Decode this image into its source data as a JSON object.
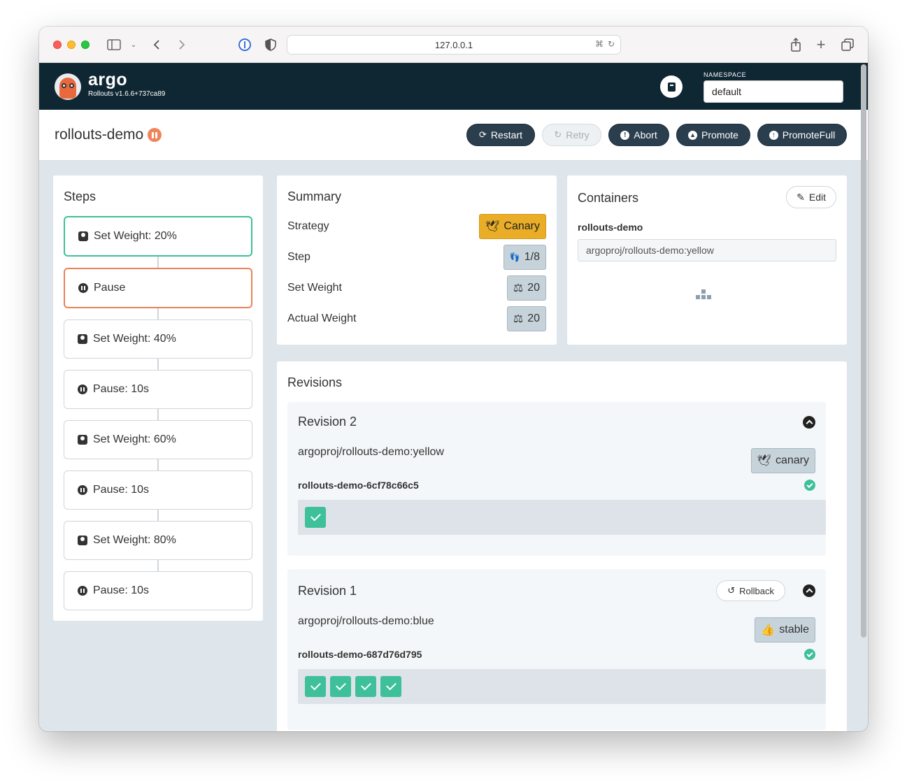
{
  "browser": {
    "url": "127.0.0.1"
  },
  "app": {
    "brand": "argo",
    "version": "Rollouts v1.6.6+737ca89",
    "namespace_label": "NAMESPACE",
    "namespace_value": "default"
  },
  "rollout": {
    "name": "rollouts-demo",
    "status": "paused",
    "actions": {
      "restart": "Restart",
      "retry": "Retry",
      "abort": "Abort",
      "promote": "Promote",
      "promote_full": "PromoteFull"
    }
  },
  "steps": {
    "title": "Steps",
    "items": [
      {
        "label": "Set Weight: 20%",
        "type": "weight",
        "state": "done"
      },
      {
        "label": "Pause",
        "type": "pause",
        "state": "current"
      },
      {
        "label": "Set Weight: 40%",
        "type": "weight",
        "state": "pending"
      },
      {
        "label": "Pause: 10s",
        "type": "pause",
        "state": "pending"
      },
      {
        "label": "Set Weight: 60%",
        "type": "weight",
        "state": "pending"
      },
      {
        "label": "Pause: 10s",
        "type": "pause",
        "state": "pending"
      },
      {
        "label": "Set Weight: 80%",
        "type": "weight",
        "state": "pending"
      },
      {
        "label": "Pause: 10s",
        "type": "pause",
        "state": "pending"
      }
    ]
  },
  "summary": {
    "title": "Summary",
    "rows": [
      {
        "label": "Strategy",
        "value": "Canary",
        "icon": "dove-icon"
      },
      {
        "label": "Step",
        "value": "1/8",
        "icon": "shoe-prints-icon"
      },
      {
        "label": "Set Weight",
        "value": "20",
        "icon": "balance-scale-icon"
      },
      {
        "label": "Actual Weight",
        "value": "20",
        "icon": "balance-scale-icon"
      }
    ]
  },
  "containers": {
    "title": "Containers",
    "edit_label": "Edit",
    "name": "rollouts-demo",
    "image": "argoproj/rollouts-demo:yellow"
  },
  "revisions": {
    "title": "Revisions",
    "items": [
      {
        "title": "Revision 2",
        "image": "argoproj/rollouts-demo:yellow",
        "badge": "canary",
        "replicaset": "rollouts-demo-6cf78c66c5",
        "pods": 1
      },
      {
        "title": "Revision 1",
        "rollback_label": "Rollback",
        "image": "argoproj/rollouts-demo:blue",
        "badge": "stable",
        "replicaset": "rollouts-demo-687d76d795",
        "pods": 4
      }
    ]
  },
  "colors": {
    "header_bg": "#0f2733",
    "button_dark": "#2b3e4e",
    "success": "#3ec09a",
    "paused": "#f0855c",
    "canary": "#e9ad27"
  }
}
